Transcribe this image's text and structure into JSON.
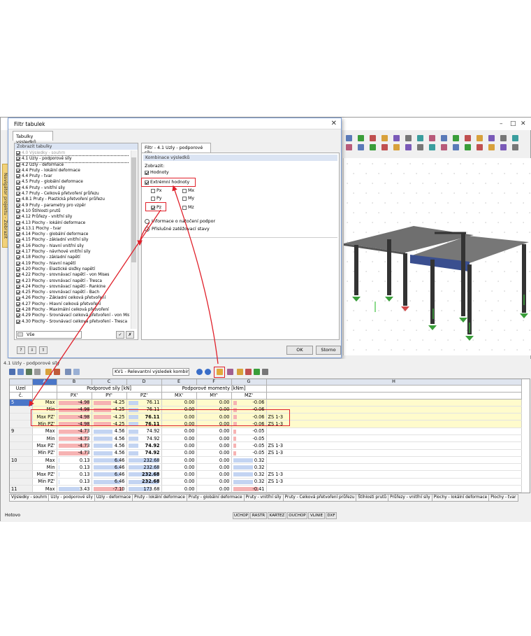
{
  "dialog": {
    "title": "Filtr tabulek",
    "tab_results": "Tabulky výsledků",
    "left_header": "Zobrazit tabulky",
    "tree": [
      {
        "label": "4.0 Výsledky - souhrn",
        "checked": true,
        "dim": true
      },
      {
        "label": "4.1 Uzly - podporové síly",
        "checked": true,
        "selected": true
      },
      {
        "label": "4.2 Uzly - deformace",
        "checked": true
      },
      {
        "label": "4.4 Pruty - lokální deformace",
        "checked": true
      },
      {
        "label": "4.4 Pruty - tvar",
        "checked": true
      },
      {
        "label": "4.5 Pruty - globální deformace",
        "checked": true
      },
      {
        "label": "4.6 Pruty - vnitřní síly",
        "checked": true
      },
      {
        "label": "4.7 Pruty - Celková přetvoření průřezu",
        "checked": true
      },
      {
        "label": "4.8.1 Pruty - Plastická přetvoření průřezu",
        "checked": true
      },
      {
        "label": "4.9 Pruty - parametry pro vzpěr",
        "checked": true
      },
      {
        "label": "4.10 Štíhlosti prutů",
        "checked": true
      },
      {
        "label": "4.12 Průřezy - vnitřní síly",
        "checked": true
      },
      {
        "label": "4.13 Plochy - lokální deformace",
        "checked": true
      },
      {
        "label": "4.13.1 Plochy - tvar",
        "checked": true
      },
      {
        "label": "4.14 Plochy - globální deformace",
        "checked": true
      },
      {
        "label": "4.15 Plochy - základní vnitřní síly",
        "checked": true
      },
      {
        "label": "4.16 Plochy - hlavní vnitřní síly",
        "checked": true
      },
      {
        "label": "4.17 Plochy - návrhové vnitřní síly",
        "checked": true
      },
      {
        "label": "4.18 Plochy - základní napětí",
        "checked": true
      },
      {
        "label": "4.19 Plochy - hlavní napětí",
        "checked": true
      },
      {
        "label": "4.20 Plochy - Elastické složky napětí",
        "checked": true
      },
      {
        "label": "4.22 Plochy - srovnávací napětí - von Mises",
        "checked": true
      },
      {
        "label": "4.23 Plochy - srovnávací napětí - Tresca",
        "checked": true
      },
      {
        "label": "4.24 Plochy - srovnávací napětí - Rankine",
        "checked": true
      },
      {
        "label": "4.25 Plochy - srovnávací napětí - Bach",
        "checked": true
      },
      {
        "label": "4.26 Plochy - Základní celková přetvoření",
        "checked": true
      },
      {
        "label": "4.27 Plochy - Hlavní celková přetvoření",
        "checked": true
      },
      {
        "label": "4.28 Plochy - Maximální celková přetvoření",
        "checked": true
      },
      {
        "label": "4.29 Plochy - Srovnávací celková přetvoření - von Mises",
        "checked": true
      },
      {
        "label": "4.30 Plochy - Srovnávací celková přetvoření - Tresca",
        "checked": true
      }
    ],
    "all_combo": "Vše",
    "right_tab": "Filtr - 4.1 Uzly - podporové síly",
    "komb_header": "Kombinace výsledků",
    "show_label": "Zobrazit:",
    "opt_values": "Hodnoty",
    "opt_extreme": "Extrémní hodnoty",
    "comp": {
      "px": "Px",
      "py": "Py",
      "pz": "Pz",
      "mx": "Mx",
      "my": "My",
      "mz": "Mz"
    },
    "radio1": "Informace o natočení podpor",
    "radio2": "Příslušné zatěžovací stavy",
    "ok": "OK",
    "cancel": "Storno"
  },
  "nav_tab": "Navigátor projektu - Zobrazit",
  "panel": {
    "title": "4.1 Uzly - podporové síly",
    "combo": "KV1 - Relevantní výsledek kombina",
    "col_letters": [
      "A",
      "B",
      "C",
      "D",
      "E",
      "F",
      "G",
      "H"
    ],
    "uzel1": "Uzel",
    "uzel2": "č.",
    "group_forces": "Podporové síly [kN]",
    "group_moments": "Podporové momenty [kNm]",
    "sub": [
      "PX'",
      "PY'",
      "PZ'",
      "MX'",
      "MY'",
      "MZ'"
    ],
    "rows": [
      {
        "uzel": "5",
        "label": "Max",
        "v": [
          "-4.98",
          "-4.25",
          "76.11",
          "0.00",
          "0.00",
          "-0.06"
        ],
        "zs": "",
        "yellow": true,
        "sel": true,
        "bold": false
      },
      {
        "uzel": "",
        "label": "Min",
        "v": [
          "-4.98",
          "-4.25",
          "76.11",
          "0.00",
          "0.00",
          "-0.06"
        ],
        "zs": "",
        "yellow": true,
        "bold": false
      },
      {
        "uzel": "",
        "label": "Max PZ'",
        "v": [
          "-4.98",
          "-4.25",
          "76.11",
          "0.00",
          "0.00",
          "-0.06"
        ],
        "zs": "ZS 1-3",
        "yellow": true,
        "bold": true
      },
      {
        "uzel": "",
        "label": "Min PZ'",
        "v": [
          "-4.98",
          "-4.25",
          "76.11",
          "0.00",
          "0.00",
          "-0.06"
        ],
        "zs": "ZS 1-3",
        "yellow": true,
        "bold": true
      },
      {
        "uzel": "9",
        "label": "Max",
        "v": [
          "-4.73",
          "4.56",
          "74.92",
          "0.00",
          "0.00",
          "-0.05"
        ],
        "zs": "",
        "bold": false
      },
      {
        "uzel": "",
        "label": "Min",
        "v": [
          "-4.73",
          "4.56",
          "74.92",
          "0.00",
          "0.00",
          "-0.05"
        ],
        "zs": "",
        "bold": false
      },
      {
        "uzel": "",
        "label": "Max PZ'",
        "v": [
          "-4.73",
          "4.56",
          "74.92",
          "0.00",
          "0.00",
          "-0.05"
        ],
        "zs": "ZS 1-3",
        "bold": true
      },
      {
        "uzel": "",
        "label": "Min PZ'",
        "v": [
          "-4.73",
          "4.56",
          "74.92",
          "0.00",
          "0.00",
          "-0.05"
        ],
        "zs": "ZS 1-3",
        "bold": true
      },
      {
        "uzel": "10",
        "label": "Max",
        "v": [
          "0.13",
          "6.46",
          "232.68",
          "0.00",
          "0.00",
          "0.32"
        ],
        "zs": "",
        "bold": false
      },
      {
        "uzel": "",
        "label": "Min",
        "v": [
          "0.13",
          "6.46",
          "232.68",
          "0.00",
          "0.00",
          "0.32"
        ],
        "zs": "",
        "bold": false
      },
      {
        "uzel": "",
        "label": "Max PZ'",
        "v": [
          "0.13",
          "6.46",
          "232.68",
          "0.00",
          "0.00",
          "0.32"
        ],
        "zs": "ZS 1-3",
        "bold": true
      },
      {
        "uzel": "",
        "label": "Min PZ'",
        "v": [
          "0.13",
          "6.46",
          "232.68",
          "0.00",
          "0.00",
          "0.32"
        ],
        "zs": "ZS 1-3",
        "bold": true
      },
      {
        "uzel": "11",
        "label": "Max",
        "v": [
          "3.43",
          "-7.10",
          "173.68",
          "0.00",
          "0.00",
          "-0.41"
        ],
        "zs": "",
        "bold": false
      }
    ],
    "tabs": [
      "Výsledky - souhrn",
      "Uzly - podporové síly",
      "Uzly - deformace",
      "Pruty - lokální deformace",
      "Pruty - globální deformace",
      "Pruty - vnitřní síly",
      "Pruty - Celková přetvoření průřezu",
      "Štíhlosti prutů",
      "Průřezy - vnitřní síly",
      "Plochy - lokální deformace",
      "Plochy - tvar"
    ]
  },
  "status": {
    "ready": "Hotovo",
    "buttons": [
      "UCHOP",
      "RASTR",
      "KARTEZ",
      "OUCHOP",
      "VLINIE",
      "DXF"
    ]
  }
}
